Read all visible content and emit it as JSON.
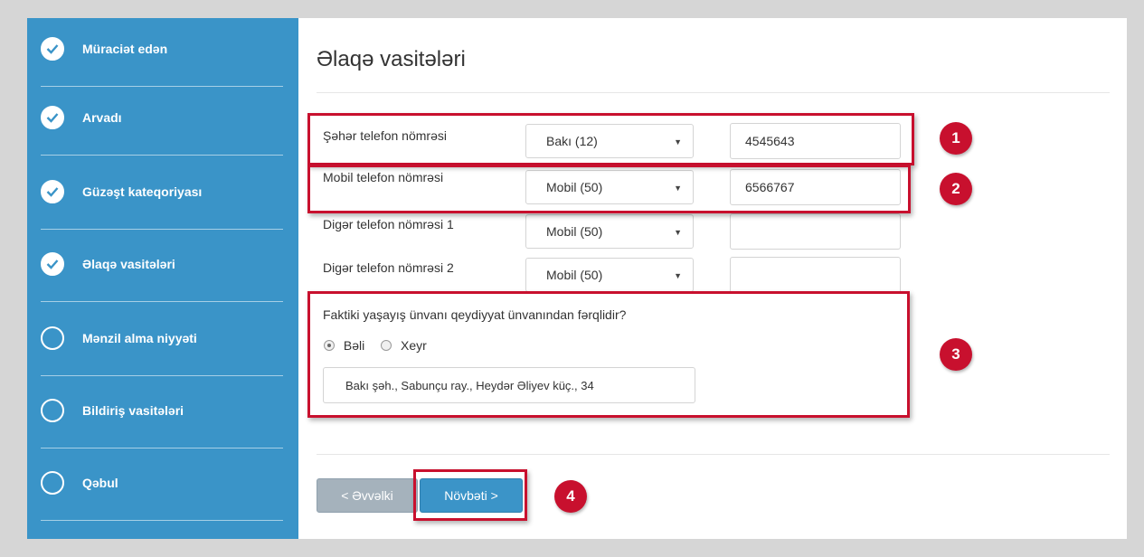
{
  "sidebar": {
    "steps": [
      {
        "label": "Müraciət edən",
        "done": true
      },
      {
        "label": "Arvadı",
        "done": true
      },
      {
        "label": "Güzəşt kateqoriyası",
        "done": true
      },
      {
        "label": "Əlaqə vasitələri",
        "done": true
      },
      {
        "label": "Mənzil alma niyyəti",
        "done": false
      },
      {
        "label": "Bildiriş vasitələri",
        "done": false
      },
      {
        "label": "Qəbul",
        "done": false
      }
    ]
  },
  "main": {
    "title": "Əlaqə vasitələri",
    "phones": [
      {
        "label": "Şəhər telefon nömrəsi",
        "code": "Bakı (12)",
        "number": "4545643"
      },
      {
        "label": "Mobil telefon nömrəsi",
        "code": "Mobil (50)",
        "number": "6566767"
      },
      {
        "label": "Digər telefon nömrəsi 1",
        "code": "Mobil (50)",
        "number": ""
      },
      {
        "label": "Digər telefon nömrəsi 2",
        "code": "Mobil (50)",
        "number": ""
      }
    ],
    "address_question": "Faktiki yaşayış ünvanı qeydiyyat ünvanından fərqlidir?",
    "radio_yes": "Bəli",
    "radio_no": "Xeyr",
    "radio_selected": "yes",
    "address_value": "Bakı şəh., Sabunçu ray., Heydər Əliyev küç., 34",
    "prev_label": "< Əvvəlki",
    "next_label": "Növbəti >"
  },
  "annotations": [
    "1",
    "2",
    "3",
    "4"
  ],
  "colors": {
    "sidebar": "#3a94c8",
    "highlight": "#c8102e",
    "next_button": "#3b94c8",
    "prev_button": "#a5b2bc"
  },
  "icons": {
    "done": "check-icon",
    "arrow": "dropdown-arrow-icon"
  }
}
